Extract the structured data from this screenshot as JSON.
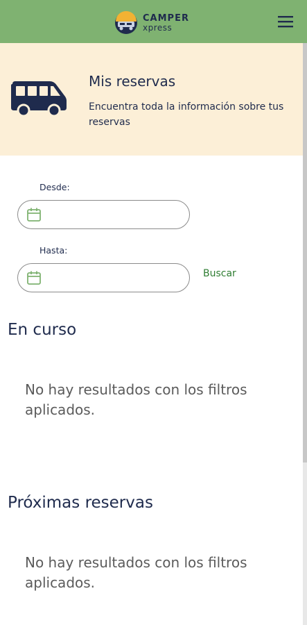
{
  "header": {
    "logo_brand": "CAMPER",
    "logo_sub": "xpress",
    "menu_icon": "hamburger-menu-icon",
    "background_color": "#7fb271"
  },
  "banner": {
    "icon": "van-icon",
    "title": "Mis reservas",
    "description": "Encuentra toda la información sobre tus reservas",
    "background_color": "#fcefd7"
  },
  "filters": {
    "from_label": "Desde:",
    "from_value": "",
    "to_label": "Hasta:",
    "to_value": "",
    "search_label": "Buscar",
    "calendar_icon": "calendar-icon"
  },
  "sections": {
    "in_progress": {
      "title": "En curso",
      "empty_message": "No hay resultados con los filtros aplicados."
    },
    "upcoming": {
      "title": "Próximas reservas",
      "empty_message": "No hay resultados con los filtros aplicados."
    }
  },
  "colors": {
    "text_primary": "#1f2b4d",
    "accent_green": "#2e7d32",
    "muted_text": "#5b5b5b"
  }
}
